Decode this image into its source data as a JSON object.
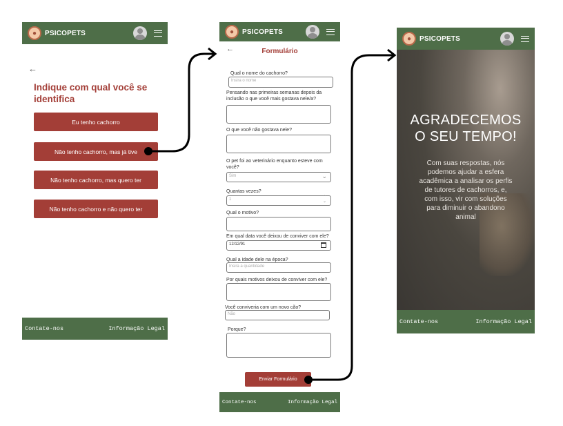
{
  "brand": "PSICOPETS",
  "footer": {
    "contact": "Contate-nos",
    "legal": "Informação Legal"
  },
  "screen1": {
    "heading": "Indique com qual você se identifica",
    "options": [
      "Eu tenho cachorro",
      "Não tenho cachorro, mas já tive",
      "Não tenho cachorro, mas quero ter",
      "Não tenho cachorro e não quero ter"
    ]
  },
  "screen2": {
    "title": "Formulário",
    "q_name": "Qual o nome do cachorro?",
    "name_placeholder": "Insira o nome",
    "q_liked": "Pensando nas primeiras semanas depois da inclusão o que você mais gostava nele/a?",
    "q_disliked": "O que você não gostava nele?",
    "q_vet": "O pet foi ao veterinário enquanto esteve com você?",
    "vet_value": "Sim",
    "q_times": "Quantas vezes?",
    "times_value": "1",
    "q_reason": "Qual o motivo?",
    "q_date": "Em qual data você deixou de conviver com ele?",
    "date_value": "12/12/91",
    "q_age": "Qual a idade dele na época?",
    "age_placeholder": "Insira a quantidade",
    "q_why_left": "Por quais motivos deixou de conviver com ele?",
    "q_new_dog": "Você conviveria com um novo cão?",
    "new_dog_value": "Não",
    "q_why": "Porque?",
    "submit": "Enviar Formulário"
  },
  "screen3": {
    "headline": "AGRADECEMOS O SEU TEMPO!",
    "message": "Com suas respostas, nós podemos ajudar a esfera acadêmica a analisar os perfis de tutores de cachorros, e, com isso, vir com soluções para diminuir o abandono animal"
  },
  "colors": {
    "header": "#4e6e48",
    "button": "#a33e37",
    "heading": "#a33e37"
  },
  "icons": [
    "paw-logo-icon",
    "user-avatar-icon",
    "hamburger-menu-icon",
    "back-arrow-icon",
    "chevron-down-icon",
    "stepper-icon",
    "calendar-icon"
  ]
}
